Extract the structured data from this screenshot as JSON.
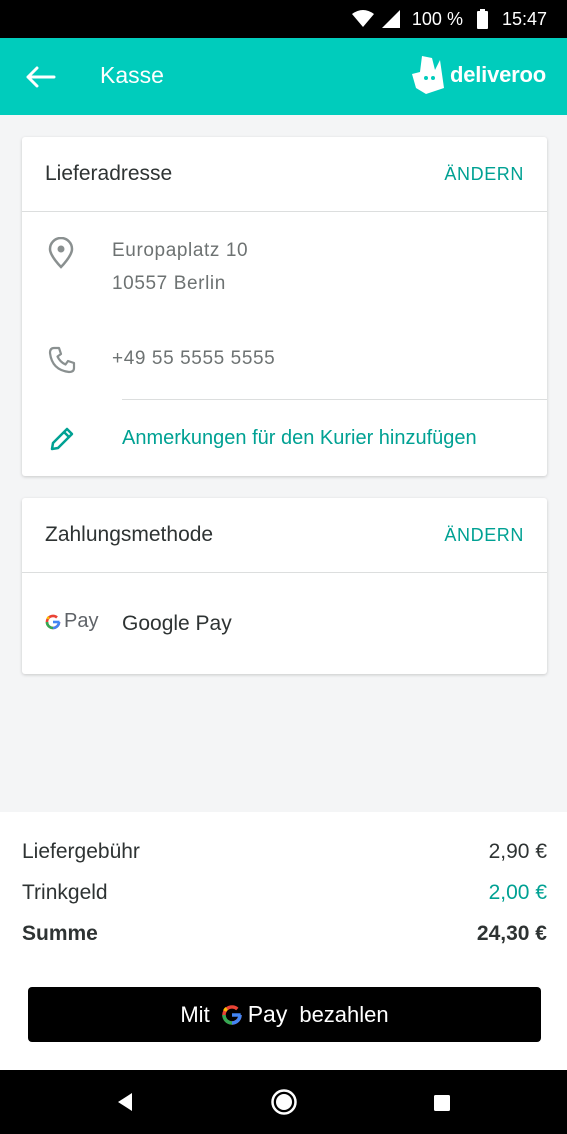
{
  "status_bar": {
    "battery": "100 %",
    "time": "15:47"
  },
  "app_bar": {
    "title": "Kasse",
    "brand": "deliveroo"
  },
  "address_card": {
    "title": "Lieferadresse",
    "change_label": "ÄNDERN",
    "address_line1": "Europaplatz 10",
    "address_line2": "10557 Berlin",
    "phone": "+49 55 5555 5555",
    "note_label": "Anmerkungen für den Kurier hinzufügen"
  },
  "payment_card": {
    "title": "Zahlungsmethode",
    "change_label": "ÄNDERN",
    "method_logo_text": "Pay",
    "method_name": "Google Pay"
  },
  "summary": {
    "delivery_fee_label": "Liefergebühr",
    "delivery_fee_value": "2,90 €",
    "tip_label": "Trinkgeld",
    "tip_value": "2,00 €",
    "total_label": "Summe",
    "total_value": "24,30 €"
  },
  "pay_button": {
    "prefix": "Mit",
    "pay": "Pay",
    "suffix": "bezahlen"
  },
  "colors": {
    "accent": "#00ccbc",
    "accent_text": "#00a193",
    "text": "#2e3333",
    "muted": "#6d7272"
  },
  "icons": [
    "back-arrow-icon",
    "deliveroo-kangaroo-icon",
    "location-pin-icon",
    "phone-icon",
    "pencil-icon",
    "google-g-icon",
    "wifi-icon",
    "signal-icon",
    "battery-icon",
    "nav-back-icon",
    "nav-home-icon",
    "nav-recent-icon"
  ]
}
